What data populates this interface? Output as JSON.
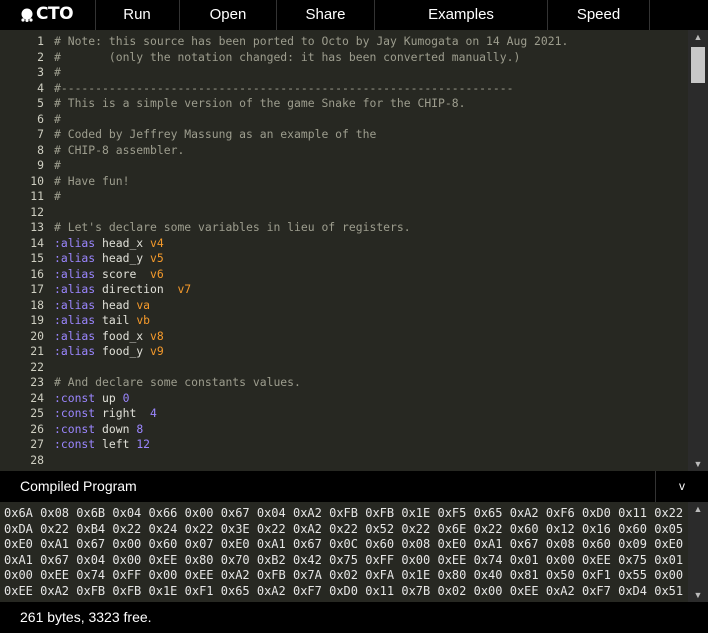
{
  "app": {
    "logo_text": "CTO"
  },
  "nav": {
    "run": "Run",
    "open": "Open",
    "share": "Share",
    "examples": "Examples",
    "speed": "Speed"
  },
  "editor": {
    "line_numbers": [
      "1",
      "2",
      "3",
      "4",
      "5",
      "6",
      "7",
      "8",
      "9",
      "10",
      "11",
      "12",
      "13",
      "14",
      "15",
      "16",
      "17",
      "18",
      "19",
      "20",
      "21",
      "22",
      "23",
      "24",
      "25",
      "26",
      "27",
      "28"
    ],
    "lines": [
      [
        {
          "t": "# Note: this source has been ported to Octo by Jay Kumogata on 14 Aug 2021.",
          "c": "cm"
        }
      ],
      [
        {
          "t": "#       (only the notation changed: it has been converted manually.)",
          "c": "cm"
        }
      ],
      [
        {
          "t": "#",
          "c": "cm"
        }
      ],
      [
        {
          "t": "#------------------------------------------------------------------",
          "c": "cm"
        }
      ],
      [
        {
          "t": "# This is a simple version of the game Snake for the CHIP-8.",
          "c": "cm"
        }
      ],
      [
        {
          "t": "#",
          "c": "cm"
        }
      ],
      [
        {
          "t": "# Coded by Jeffrey Massung as an example of the",
          "c": "cm"
        }
      ],
      [
        {
          "t": "# CHIP-8 assembler.",
          "c": "cm"
        }
      ],
      [
        {
          "t": "#",
          "c": "cm"
        }
      ],
      [
        {
          "t": "# Have fun!",
          "c": "cm"
        }
      ],
      [
        {
          "t": "#",
          "c": "cm"
        }
      ],
      [],
      [
        {
          "t": "# Let's declare some variables in lieu of registers.",
          "c": "cm"
        }
      ],
      [
        {
          "t": ":alias",
          "c": "kw"
        },
        {
          "t": " head_x ",
          "c": "id"
        },
        {
          "t": "v4",
          "c": "reg"
        }
      ],
      [
        {
          "t": ":alias",
          "c": "kw"
        },
        {
          "t": " head_y ",
          "c": "id"
        },
        {
          "t": "v5",
          "c": "reg"
        }
      ],
      [
        {
          "t": ":alias",
          "c": "kw"
        },
        {
          "t": " score  ",
          "c": "id"
        },
        {
          "t": "v6",
          "c": "reg"
        }
      ],
      [
        {
          "t": ":alias",
          "c": "kw"
        },
        {
          "t": " direction  ",
          "c": "id"
        },
        {
          "t": "v7",
          "c": "reg"
        }
      ],
      [
        {
          "t": ":alias",
          "c": "kw"
        },
        {
          "t": " head ",
          "c": "id"
        },
        {
          "t": "va",
          "c": "reg"
        }
      ],
      [
        {
          "t": ":alias",
          "c": "kw"
        },
        {
          "t": " tail ",
          "c": "id"
        },
        {
          "t": "vb",
          "c": "reg"
        }
      ],
      [
        {
          "t": ":alias",
          "c": "kw"
        },
        {
          "t": " food_x ",
          "c": "id"
        },
        {
          "t": "v8",
          "c": "reg"
        }
      ],
      [
        {
          "t": ":alias",
          "c": "kw"
        },
        {
          "t": " food_y ",
          "c": "id"
        },
        {
          "t": "v9",
          "c": "reg"
        }
      ],
      [],
      [
        {
          "t": "# And declare some constants values.",
          "c": "cm"
        }
      ],
      [
        {
          "t": ":const",
          "c": "kw"
        },
        {
          "t": " up ",
          "c": "id"
        },
        {
          "t": "0",
          "c": "num"
        }
      ],
      [
        {
          "t": ":const",
          "c": "kw"
        },
        {
          "t": " right  ",
          "c": "id"
        },
        {
          "t": "4",
          "c": "num"
        }
      ],
      [
        {
          "t": ":const",
          "c": "kw"
        },
        {
          "t": " down ",
          "c": "id"
        },
        {
          "t": "8",
          "c": "num"
        }
      ],
      [
        {
          "t": ":const",
          "c": "kw"
        },
        {
          "t": " left ",
          "c": "id"
        },
        {
          "t": "12",
          "c": "num"
        }
      ],
      []
    ]
  },
  "compiled": {
    "title": "Compiled Program",
    "toggle_label": "v",
    "hex_lines": [
      "0x6A 0x08 0x6B 0x04 0x66 0x00 0x67 0x04 0xA2 0xFB 0xFB 0x1E 0xF5 0x65 0xA2 0xF6 0xD0 0x11 0x22",
      "0xDA 0x22 0xB4 0x22 0x24 0x22 0x3E 0x22 0xA2 0x22 0x52 0x22 0x6E 0x22 0x60 0x12 0x16 0x60 0x05",
      "0xE0 0xA1 0x67 0x00 0x60 0x07 0xE0 0xA1 0x67 0x0C 0x60 0x08 0xE0 0xA1 0x67 0x08 0x60 0x09 0xE0",
      "0xA1 0x67 0x04 0x00 0xEE 0x80 0x70 0xB2 0x42 0x75 0xFF 0x00 0xEE 0x74 0x01 0x00 0xEE 0x75 0x01",
      "0x00 0xEE 0x74 0xFF 0x00 0xEE 0xA2 0xFB 0x7A 0x02 0xFA 0x1E 0x80 0x40 0x81 0x50 0xF1 0x55 0x00",
      "0xEE 0xA2 0xFB 0xFB 0x1E 0xF1 0x65 0xA2 0xF7 0xD0 0x11 0x7B 0x02 0x00 0xEE 0xA2 0xF7 0xD4 0x51"
    ]
  },
  "status": {
    "text": "261 bytes, 3323 free."
  }
}
